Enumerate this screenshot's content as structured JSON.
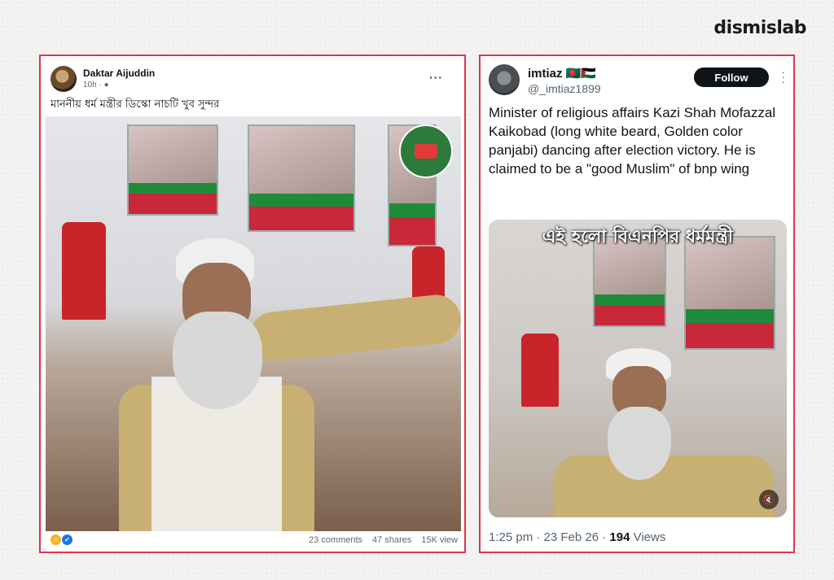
{
  "brand": {
    "logo_text": "dismislab"
  },
  "facebook_post": {
    "author": "Daktar Aijuddin",
    "time": "10h ·",
    "caption": "মাননীয় ধর্ম মন্ত্রীর ডিস্কো নাচটি খুব সুন্দর",
    "stats": {
      "comments": "23 comments",
      "shares": "47 shares",
      "views": "15K view"
    },
    "icons": [
      "haha-reaction-icon",
      "like-reaction-icon",
      "more-icon",
      "globe-icon"
    ]
  },
  "x_post": {
    "display_name": "imtiaz 🇧🇩🇵🇸",
    "handle": "@_imtiaz1899",
    "follow_label": "Follow",
    "text": "Minister of religious affairs Kazi Shah Mofazzal Kaikobad (long white beard, Golden color panjabi) dancing after election victory. He is claimed to be a \"good Muslim\" of bnp wing",
    "video_overlay_text": "এই হলো বিএনপির ধর্মমন্ত্রী",
    "meta_time": "1:25 pm · 23 Feb 26 · ",
    "views_count": "194",
    "views_label": " Views"
  },
  "colors": {
    "panel_border": "#e5324c",
    "x_follow_bg": "#0f1419",
    "fb_like": "#1877f2",
    "fb_haha": "#f7b125"
  }
}
